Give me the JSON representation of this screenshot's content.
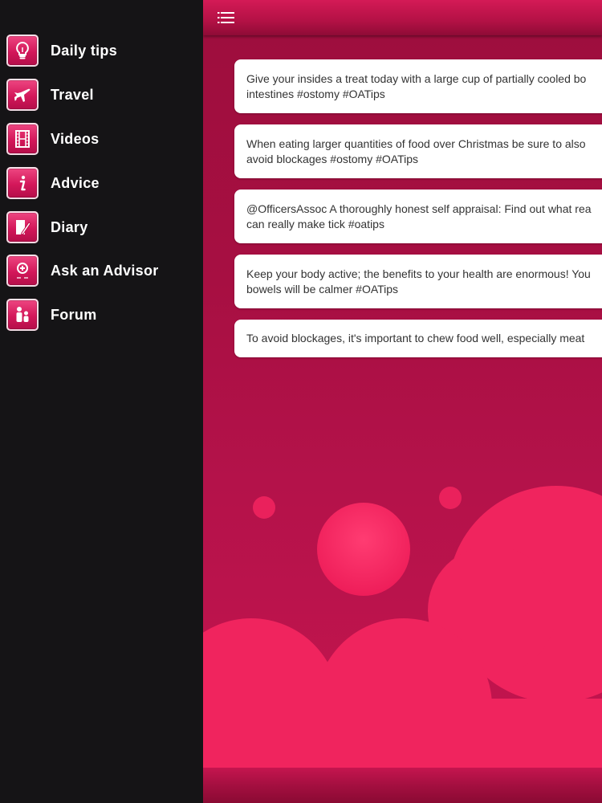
{
  "sidebar": {
    "items": [
      {
        "label": "Daily tips",
        "icon": "lightbulb-icon"
      },
      {
        "label": "Travel",
        "icon": "airplane-icon"
      },
      {
        "label": "Videos",
        "icon": "film-icon"
      },
      {
        "label": "Advice",
        "icon": "info-icon"
      },
      {
        "label": "Diary",
        "icon": "notepad-pen-icon"
      },
      {
        "label": "Ask an Advisor",
        "icon": "question-answer-icon"
      },
      {
        "label": "Forum",
        "icon": "people-icon"
      }
    ]
  },
  "topbar": {
    "menu_icon": "list-menu-icon"
  },
  "tips": [
    "Give your insides a treat today with a large cup of partially cooled bo\nintestines #ostomy #OATips",
    "When eating larger quantities of food over Christmas be sure to also\navoid blockages #ostomy #OATips",
    "@OfficersAssoc A thoroughly honest self appraisal: Find out what rea\ncan really make tick #oatips",
    "Keep your body active; the benefits to your health are enormous! You\nbowels will be calmer #OATips",
    "To avoid blockages, it's important to chew food well, especially meat"
  ],
  "colors": {
    "accent": "#d3175a",
    "sidebar_bg": "#151416",
    "panel_bg": "#a70f42",
    "bubble": "#f0245e"
  }
}
